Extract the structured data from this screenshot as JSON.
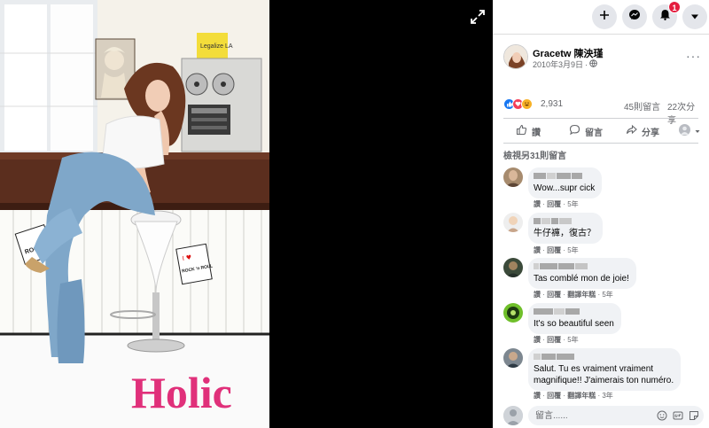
{
  "photo": {
    "sign_text": "Legalize LA",
    "brand_text": "Holic",
    "sign_left_text": "ROCK",
    "sign_right_text": "ROCK 'n ROLL",
    "sign_right_heart": "I ♥"
  },
  "topbar": {
    "notification_count": "1"
  },
  "post": {
    "author_name": "Gracetw 陳泱瑾",
    "date": "2010年3月9日",
    "privacy_dot": "·",
    "more": "···",
    "reaction_count": "2,931",
    "comment_count": "45則留言",
    "share_count": "22次分享",
    "like_label": "讚",
    "comment_label": "留言",
    "share_label": "分享",
    "view_more": "檢視另31則留言"
  },
  "comments": [
    {
      "text": "Wow...supr cick",
      "meta": [
        "讚",
        "回覆",
        "5年"
      ]
    },
    {
      "text": "牛仔褲，復古？",
      "meta": [
        "讚",
        "回覆",
        "5年"
      ]
    },
    {
      "text": "Tas comblé mon de joie!",
      "meta": [
        "讚",
        "回覆",
        "翻譯年糕",
        "5年"
      ]
    },
    {
      "text": "It's so beautiful seen",
      "meta": [
        "讚",
        "回覆",
        "5年"
      ]
    },
    {
      "text": "Salut. Tu es vraiment vraiment",
      "text2": "magnifique!! J'aimerais ton numéro.",
      "meta": [
        "讚",
        "回覆",
        "翻譯年糕",
        "3年"
      ]
    }
  ],
  "composer": {
    "placeholder": "留言......"
  },
  "colors": {
    "like_blue": "#1877f2",
    "love_red": "#f33e58",
    "haha_yellow": "#f7b125",
    "badge_red": "#e41e3f",
    "brand_pink": "#e0307a"
  }
}
